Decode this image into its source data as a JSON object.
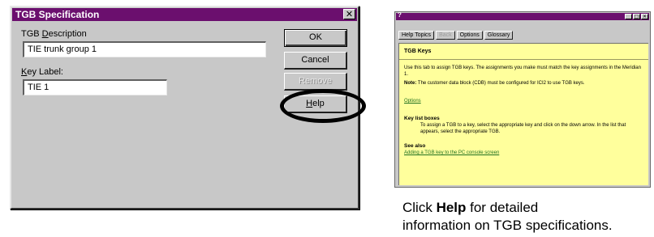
{
  "dialog": {
    "title": "TGB Specification",
    "close_glyph": "✕",
    "description_label_pre": "TGB ",
    "description_label_ul": "D",
    "description_label_post": "escription",
    "description_value": "TIE trunk group 1",
    "key_label_ul": "K",
    "key_label_post": "ey Label:",
    "key_value": "TIE 1",
    "buttons": {
      "ok": "OK",
      "cancel": "Cancel",
      "remove": "Remove",
      "help_ul": "H",
      "help_post": "elp"
    }
  },
  "help_window": {
    "title_glyph": "?",
    "window_buttons": [
      "_",
      "□",
      "✕"
    ],
    "toolbar": [
      {
        "label": "Help Topics",
        "enabled": true
      },
      {
        "label": "Back",
        "enabled": false
      },
      {
        "label": "Options",
        "enabled": true
      },
      {
        "label": "Glossary",
        "enabled": true
      }
    ],
    "heading": "TGB Keys",
    "body1": "Use this tab to assign TGB keys. The assignments you make must match the key assignments in the Meridian 1.",
    "note_label": "Note:",
    "note_text": " The customer data block (CDB) must be configured for ICI2 to use TGB keys.",
    "options_link": "Options",
    "key_list_heading": "Key list boxes",
    "key_list_text": "To assign a TGB to a key, select the appropriate key and click on the down arrow. In the list that appears, select the appropriate TGB.",
    "see_also_heading": "See also",
    "see_also_link": "Adding a TGB key to the PC console screen"
  },
  "caption": {
    "line1_pre": "Click ",
    "line1_bold": "Help",
    "line1_post": " for detailed",
    "line2": "information on TGB specifications."
  }
}
